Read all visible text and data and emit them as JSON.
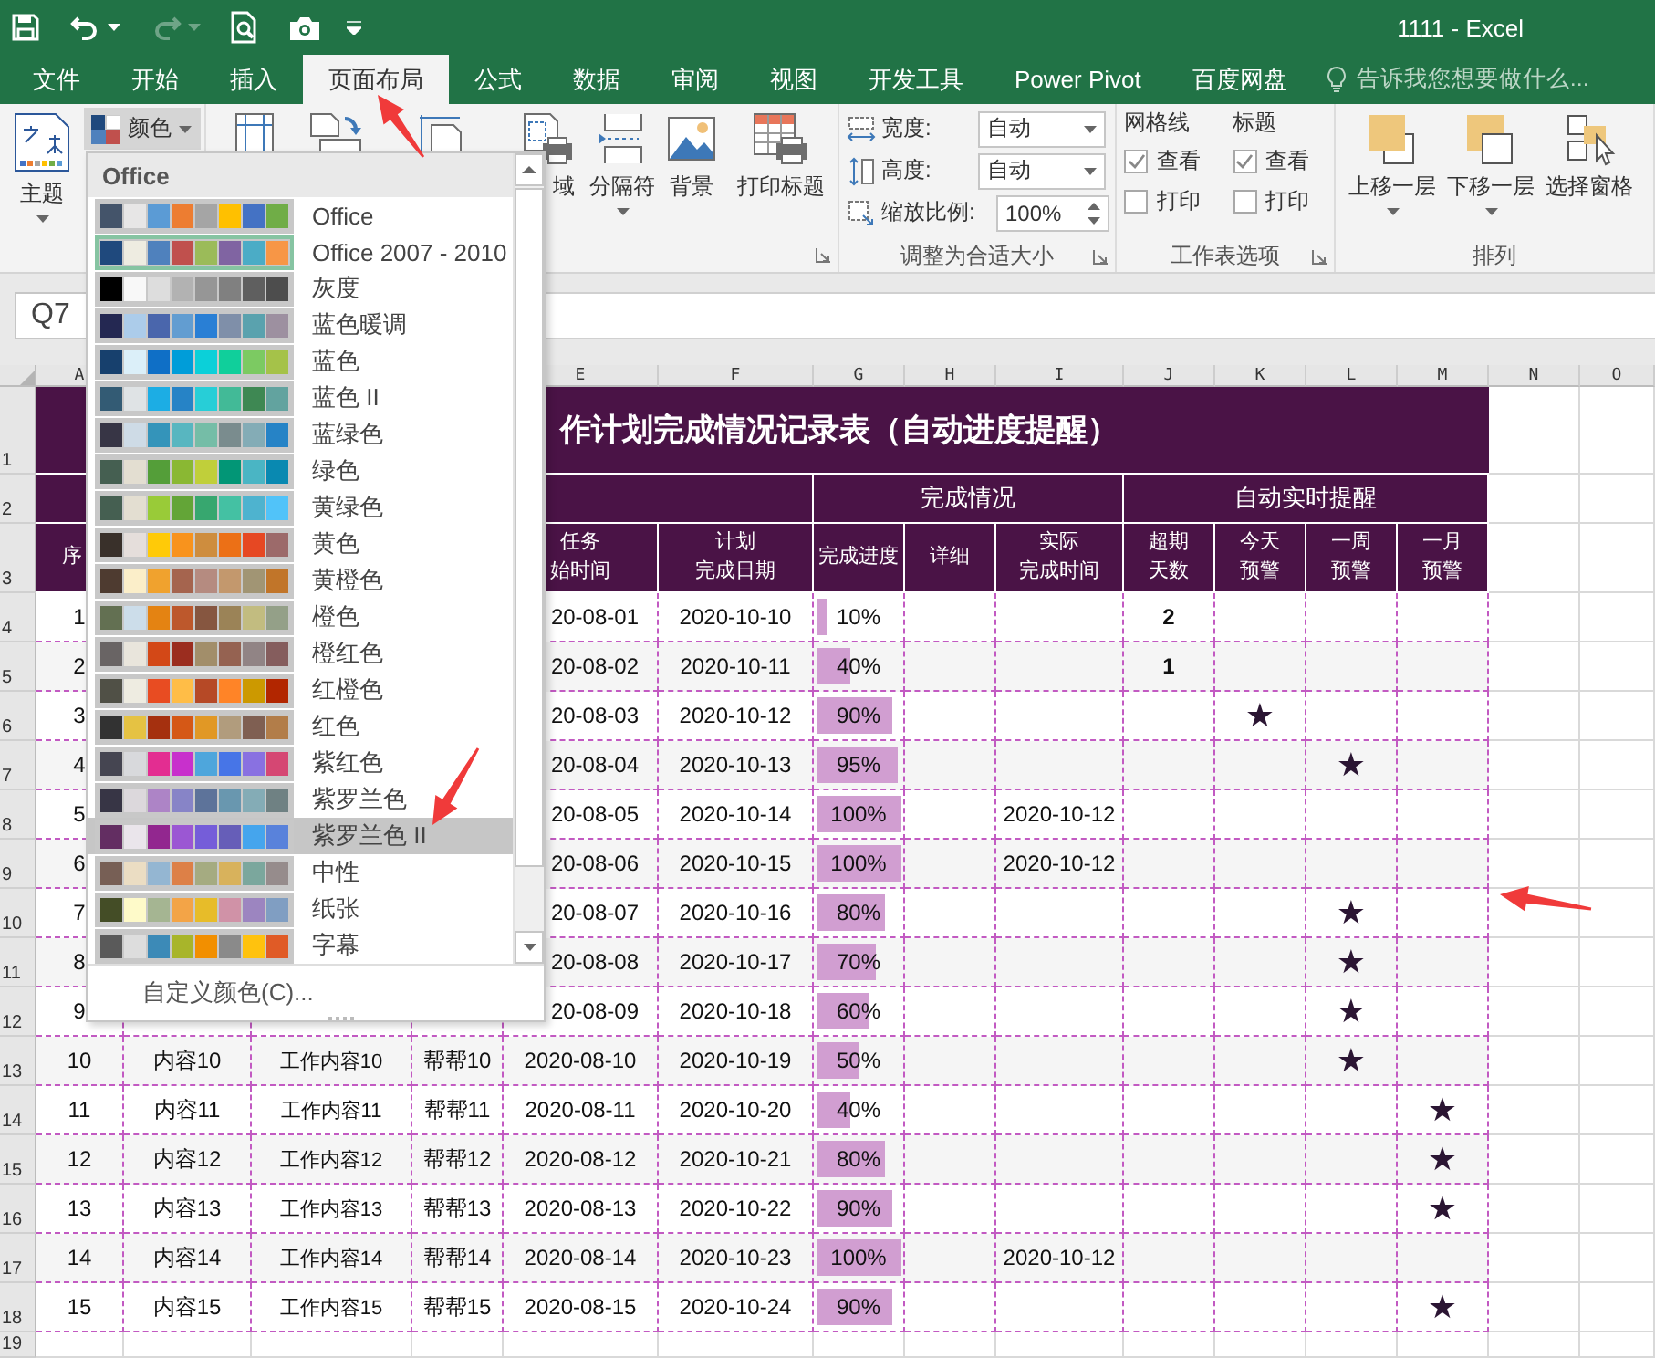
{
  "window": {
    "title": "1111 - Excel"
  },
  "quick_access": [
    {
      "kind": "save",
      "disabled": false
    },
    {
      "kind": "undo",
      "disabled": false
    },
    {
      "kind": "redo",
      "disabled": true
    },
    {
      "kind": "preview",
      "disabled": false
    },
    {
      "kind": "camera",
      "disabled": false
    }
  ],
  "tabs": [
    {
      "label": "文件",
      "selected": false
    },
    {
      "label": "开始",
      "selected": false
    },
    {
      "label": "插入",
      "selected": false
    },
    {
      "label": "页面布局",
      "selected": true
    },
    {
      "label": "公式",
      "selected": false
    },
    {
      "label": "数据",
      "selected": false
    },
    {
      "label": "审阅",
      "selected": false
    },
    {
      "label": "视图",
      "selected": false
    },
    {
      "label": "开发工具",
      "selected": false
    },
    {
      "label": "Power Pivot",
      "selected": false
    },
    {
      "label": "百度网盘",
      "selected": false
    }
  ],
  "tell_me": {
    "placeholder": "告诉我您想要做什么..."
  },
  "ribbon": {
    "themes": {
      "themes_button": "主题",
      "colors_button": {
        "label": "颜色",
        "pressed": true
      }
    },
    "page_setup": [
      {
        "kind": "margins"
      },
      {
        "kind": "orientation"
      },
      {
        "kind": "size"
      },
      {
        "kind": "print_area",
        "label": "域"
      },
      {
        "kind": "breaks",
        "label": "分隔符"
      },
      {
        "kind": "background",
        "label": "背景"
      },
      {
        "kind": "print_titles",
        "label": "打印标题"
      }
    ],
    "scale": {
      "label": "调整为合适大小",
      "rows": [
        {
          "kind": "width",
          "label": "宽度:",
          "value": "自动"
        },
        {
          "kind": "height",
          "label": "高度:",
          "value": "自动"
        },
        {
          "kind": "scale",
          "label": "缩放比例:",
          "value": "100%"
        }
      ]
    },
    "sheet_options": {
      "label": "工作表选项",
      "columns": [
        {
          "title": "网格线",
          "options": [
            {
              "label": "查看",
              "checked": true
            },
            {
              "label": "打印",
              "checked": false
            }
          ]
        },
        {
          "title": "标题",
          "options": [
            {
              "label": "查看",
              "checked": true
            },
            {
              "label": "打印",
              "checked": false
            }
          ]
        }
      ]
    },
    "arrange": {
      "label": "排列",
      "buttons": [
        {
          "kind": "forward",
          "label": "上移一层"
        },
        {
          "kind": "backward",
          "label": "下移一层"
        },
        {
          "kind": "pane",
          "label": "选择窗格"
        }
      ]
    }
  },
  "name_box": "Q7",
  "column_headers": [
    "A",
    "E",
    "F",
    "G",
    "H",
    "I",
    "J",
    "K",
    "L",
    "M",
    "N",
    "O"
  ],
  "row_numbers": [
    "1",
    "2",
    "3",
    "4",
    "5",
    "6",
    "7",
    "8",
    "9",
    "10",
    "11",
    "12",
    "13",
    "14",
    "15",
    "16",
    "17",
    "18",
    "19"
  ],
  "sheet": {
    "title": "作计划完成情况记录表（自动进度提醒）",
    "group_headers": [
      "完成情况",
      "自动实时提醒"
    ],
    "headers": {
      "a": [
        "序"
      ],
      "e": [
        "任务",
        "始时间"
      ],
      "f": [
        "计划",
        "完成日期"
      ],
      "g": [
        "完成进度"
      ],
      "h": [
        "详细"
      ],
      "i": [
        "实际",
        "完成时间"
      ],
      "j": [
        "超期",
        "天数"
      ],
      "k": [
        "今天",
        "预警"
      ],
      "l": [
        "一周",
        "预警"
      ],
      "m": [
        "一月",
        "预警"
      ]
    },
    "rows": [
      {
        "a": "1",
        "e": "20-08-01",
        "f": "2020-10-10",
        "level": 0.1,
        "g": "10%",
        "j": "2"
      },
      {
        "a": "2",
        "e": "20-08-02",
        "f": "2020-10-11",
        "level": 0.4,
        "g": "40%",
        "j": "1"
      },
      {
        "a": "3",
        "e": "20-08-03",
        "f": "2020-10-12",
        "level": 0.9,
        "g": "90%",
        "k": "★"
      },
      {
        "a": "4",
        "e": "20-08-04",
        "f": "2020-10-13",
        "level": 0.95,
        "g": "95%",
        "l": "★"
      },
      {
        "a": "5",
        "e": "20-08-05",
        "f": "2020-10-14",
        "level": 1,
        "g": "100%",
        "i": "2020-10-12"
      },
      {
        "a": "6",
        "e": "20-08-06",
        "f": "2020-10-15",
        "level": 1,
        "g": "100%",
        "i": "2020-10-12"
      },
      {
        "a": "7",
        "e": "20-08-07",
        "f": "2020-10-16",
        "level": 0.8,
        "g": "80%",
        "l": "★"
      },
      {
        "a": "8",
        "e": "20-08-08",
        "f": "2020-10-17",
        "level": 0.7,
        "g": "70%",
        "l": "★"
      },
      {
        "a": "9",
        "e": "20-08-09",
        "f": "2020-10-18",
        "level": 0.6,
        "g": "60%",
        "l": "★"
      },
      {
        "a": "10",
        "b": "内容10",
        "c": "工作内容10",
        "d": "帮帮10",
        "e": "2020-08-10",
        "f": "2020-10-19",
        "level": 0.5,
        "g": "50%",
        "l": "★"
      },
      {
        "a": "11",
        "b": "内容11",
        "c": "工作内容11",
        "d": "帮帮11",
        "e": "2020-08-11",
        "f": "2020-10-20",
        "level": 0.4,
        "g": "40%",
        "m": "★"
      },
      {
        "a": "12",
        "b": "内容12",
        "c": "工作内容12",
        "d": "帮帮12",
        "e": "2020-08-12",
        "f": "2020-10-21",
        "level": 0.8,
        "g": "80%",
        "m": "★"
      },
      {
        "a": "13",
        "b": "内容13",
        "c": "工作内容13",
        "d": "帮帮13",
        "e": "2020-08-13",
        "f": "2020-10-22",
        "level": 0.9,
        "g": "90%",
        "m": "★"
      },
      {
        "a": "14",
        "b": "内容14",
        "c": "工作内容14",
        "d": "帮帮14",
        "e": "2020-08-14",
        "f": "2020-10-23",
        "level": 1,
        "g": "100%",
        "i": "2020-10-12"
      },
      {
        "a": "15",
        "b": "内容15",
        "c": "工作内容15",
        "d": "帮帮15",
        "e": "2020-08-15",
        "f": "2020-10-24",
        "level": 0.9,
        "g": "90%",
        "m": "★"
      }
    ]
  },
  "colors_menu": {
    "header": "Office",
    "footer": "自定义颜色(C)...",
    "items": [
      {
        "name": "Office",
        "selected": false,
        "current": false,
        "swatches": [
          {
            "color": "#44546a"
          },
          {
            "color": "#e7e6e6"
          },
          {
            "color": "#5b9bd5"
          },
          {
            "color": "#ed7d31"
          },
          {
            "color": "#a5a5a5"
          },
          {
            "color": "#ffc000"
          },
          {
            "color": "#4472c4"
          },
          {
            "color": "#70ad47"
          }
        ]
      },
      {
        "name": "Office 2007 - 2010",
        "selected": false,
        "current": true,
        "swatches": [
          {
            "color": "#1f497d"
          },
          {
            "color": "#eeece1"
          },
          {
            "color": "#4f81bd"
          },
          {
            "color": "#c0504d"
          },
          {
            "color": "#9bbb59"
          },
          {
            "color": "#8064a2"
          },
          {
            "color": "#4bacc6"
          },
          {
            "color": "#f79646"
          }
        ]
      },
      {
        "name": "灰度",
        "selected": false,
        "current": false,
        "swatches": [
          {
            "color": "#000000"
          },
          {
            "color": "#f8f8f8"
          },
          {
            "color": "#dddddd"
          },
          {
            "color": "#b2b2b2"
          },
          {
            "color": "#969696"
          },
          {
            "color": "#808080"
          },
          {
            "color": "#5f5f5f"
          },
          {
            "color": "#4d4d4d"
          }
        ]
      },
      {
        "name": "蓝色暖调",
        "selected": false,
        "current": false,
        "swatches": [
          {
            "color": "#242852"
          },
          {
            "color": "#acccea"
          },
          {
            "color": "#4a66ac"
          },
          {
            "color": "#629dd1"
          },
          {
            "color": "#297fd5"
          },
          {
            "color": "#7f8fa9"
          },
          {
            "color": "#5aa2ae"
          },
          {
            "color": "#9d90a0"
          }
        ]
      },
      {
        "name": "蓝色",
        "selected": false,
        "current": false,
        "swatches": [
          {
            "color": "#17406d"
          },
          {
            "color": "#dbeff9"
          },
          {
            "color": "#0f6fc6"
          },
          {
            "color": "#009dd9"
          },
          {
            "color": "#0bd0d9"
          },
          {
            "color": "#10cf9b"
          },
          {
            "color": "#7cca62"
          },
          {
            "color": "#a5c249"
          }
        ]
      },
      {
        "name": "蓝色 II",
        "selected": false,
        "current": false,
        "swatches": [
          {
            "color": "#335b74"
          },
          {
            "color": "#dfe3e5"
          },
          {
            "color": "#1cade4"
          },
          {
            "color": "#2683c6"
          },
          {
            "color": "#27ced7"
          },
          {
            "color": "#42ba97"
          },
          {
            "color": "#3e8853"
          },
          {
            "color": "#62a39f"
          }
        ]
      },
      {
        "name": "蓝绿色",
        "selected": false,
        "current": false,
        "swatches": [
          {
            "color": "#373545"
          },
          {
            "color": "#cedbe6"
          },
          {
            "color": "#3494ba"
          },
          {
            "color": "#58b6c0"
          },
          {
            "color": "#75bda7"
          },
          {
            "color": "#7a8c8e"
          },
          {
            "color": "#84acb6"
          },
          {
            "color": "#2683c6"
          }
        ]
      },
      {
        "name": "绿色",
        "selected": false,
        "current": false,
        "swatches": [
          {
            "color": "#455f51"
          },
          {
            "color": "#e3ded1"
          },
          {
            "color": "#549e39"
          },
          {
            "color": "#8ab833"
          },
          {
            "color": "#c0cf3a"
          },
          {
            "color": "#029676"
          },
          {
            "color": "#4ab5c4"
          },
          {
            "color": "#0989b1"
          }
        ]
      },
      {
        "name": "黄绿色",
        "selected": false,
        "current": false,
        "swatches": [
          {
            "color": "#455f51"
          },
          {
            "color": "#e3ded1"
          },
          {
            "color": "#99cb38"
          },
          {
            "color": "#63a537"
          },
          {
            "color": "#37a76f"
          },
          {
            "color": "#44c1a3"
          },
          {
            "color": "#4eb3cf"
          },
          {
            "color": "#51c3f9"
          }
        ]
      },
      {
        "name": "黄色",
        "selected": false,
        "current": false,
        "swatches": [
          {
            "color": "#39302a"
          },
          {
            "color": "#e5dedb"
          },
          {
            "color": "#ffca08"
          },
          {
            "color": "#f8931d"
          },
          {
            "color": "#ce8d3e"
          },
          {
            "color": "#ec7016"
          },
          {
            "color": "#e64823"
          },
          {
            "color": "#9c6a6a"
          }
        ]
      },
      {
        "name": "黄橙色",
        "selected": false,
        "current": false,
        "swatches": [
          {
            "color": "#4e3b30"
          },
          {
            "color": "#fbeec9"
          },
          {
            "color": "#f0a22e"
          },
          {
            "color": "#a5644e"
          },
          {
            "color": "#b58b80"
          },
          {
            "color": "#c3986d"
          },
          {
            "color": "#a19574"
          },
          {
            "color": "#c17529"
          }
        ]
      },
      {
        "name": "橙色",
        "selected": false,
        "current": false,
        "swatches": [
          {
            "color": "#637052"
          },
          {
            "color": "#ccddea"
          },
          {
            "color": "#e48312"
          },
          {
            "color": "#bd582c"
          },
          {
            "color": "#865640"
          },
          {
            "color": "#9b8357"
          },
          {
            "color": "#c2bc80"
          },
          {
            "color": "#94a088"
          }
        ]
      },
      {
        "name": "橙红色",
        "selected": false,
        "current": false,
        "swatches": [
          {
            "color": "#696464"
          },
          {
            "color": "#e9e5dc"
          },
          {
            "color": "#d34817"
          },
          {
            "color": "#9b2d1f"
          },
          {
            "color": "#a28e6a"
          },
          {
            "color": "#956251"
          },
          {
            "color": "#918485"
          },
          {
            "color": "#855d5d"
          }
        ]
      },
      {
        "name": "红橙色",
        "selected": false,
        "current": false,
        "swatches": [
          {
            "color": "#505046"
          },
          {
            "color": "#eeece1"
          },
          {
            "color": "#e84c22"
          },
          {
            "color": "#ffbd47"
          },
          {
            "color": "#b64926"
          },
          {
            "color": "#ff8427"
          },
          {
            "color": "#cc9900"
          },
          {
            "color": "#b22600"
          }
        ]
      },
      {
        "name": "红色",
        "selected": false,
        "current": false,
        "swatches": [
          {
            "color": "#323232"
          },
          {
            "color": "#e5c243"
          },
          {
            "color": "#a5300f"
          },
          {
            "color": "#d55816"
          },
          {
            "color": "#e19825"
          },
          {
            "color": "#b19c7d"
          },
          {
            "color": "#7f5f52"
          },
          {
            "color": "#b27d49"
          }
        ]
      },
      {
        "name": "紫红色",
        "selected": false,
        "current": false,
        "swatches": [
          {
            "color": "#454551"
          },
          {
            "color": "#d8d9dc"
          },
          {
            "color": "#e32d91"
          },
          {
            "color": "#c830cc"
          },
          {
            "color": "#4ea6dc"
          },
          {
            "color": "#4775e7"
          },
          {
            "color": "#8971e1"
          },
          {
            "color": "#d54773"
          }
        ]
      },
      {
        "name": "紫罗兰色",
        "selected": false,
        "current": false,
        "swatches": [
          {
            "color": "#373545"
          },
          {
            "color": "#dcd8dc"
          },
          {
            "color": "#ad84c6"
          },
          {
            "color": "#8784c7"
          },
          {
            "color": "#5d739a"
          },
          {
            "color": "#6997af"
          },
          {
            "color": "#84acb6"
          },
          {
            "color": "#6f8183"
          }
        ]
      },
      {
        "name": "紫罗兰色 II",
        "selected": true,
        "current": false,
        "swatches": [
          {
            "color": "#632e62"
          },
          {
            "color": "#eae5eb"
          },
          {
            "color": "#92278f"
          },
          {
            "color": "#9b57d3"
          },
          {
            "color": "#755dd9"
          },
          {
            "color": "#665eb8"
          },
          {
            "color": "#45a5ed"
          },
          {
            "color": "#5982db"
          }
        ]
      },
      {
        "name": "中性",
        "selected": false,
        "current": false,
        "swatches": [
          {
            "color": "#775f55"
          },
          {
            "color": "#ebddc3"
          },
          {
            "color": "#94b6d2"
          },
          {
            "color": "#dd8047"
          },
          {
            "color": "#a5ab81"
          },
          {
            "color": "#d8b25c"
          },
          {
            "color": "#7ba79d"
          },
          {
            "color": "#968c8c"
          }
        ]
      },
      {
        "name": "纸张",
        "selected": false,
        "current": false,
        "swatches": [
          {
            "color": "#444d26"
          },
          {
            "color": "#fefac9"
          },
          {
            "color": "#a5b592"
          },
          {
            "color": "#f3a447"
          },
          {
            "color": "#e7bc29"
          },
          {
            "color": "#d092a7"
          },
          {
            "color": "#9c85c0"
          },
          {
            "color": "#809ec2"
          }
        ]
      },
      {
        "name": "字幕",
        "selected": false,
        "current": false,
        "swatches": [
          {
            "color": "#5a5a5a"
          },
          {
            "color": "#dddddd"
          },
          {
            "color": "#3c8ab7"
          },
          {
            "color": "#a8b52a"
          },
          {
            "color": "#f28f00"
          },
          {
            "color": "#8a8a8a"
          },
          {
            "color": "#ffc20e"
          },
          {
            "color": "#e05b26"
          }
        ]
      }
    ]
  }
}
